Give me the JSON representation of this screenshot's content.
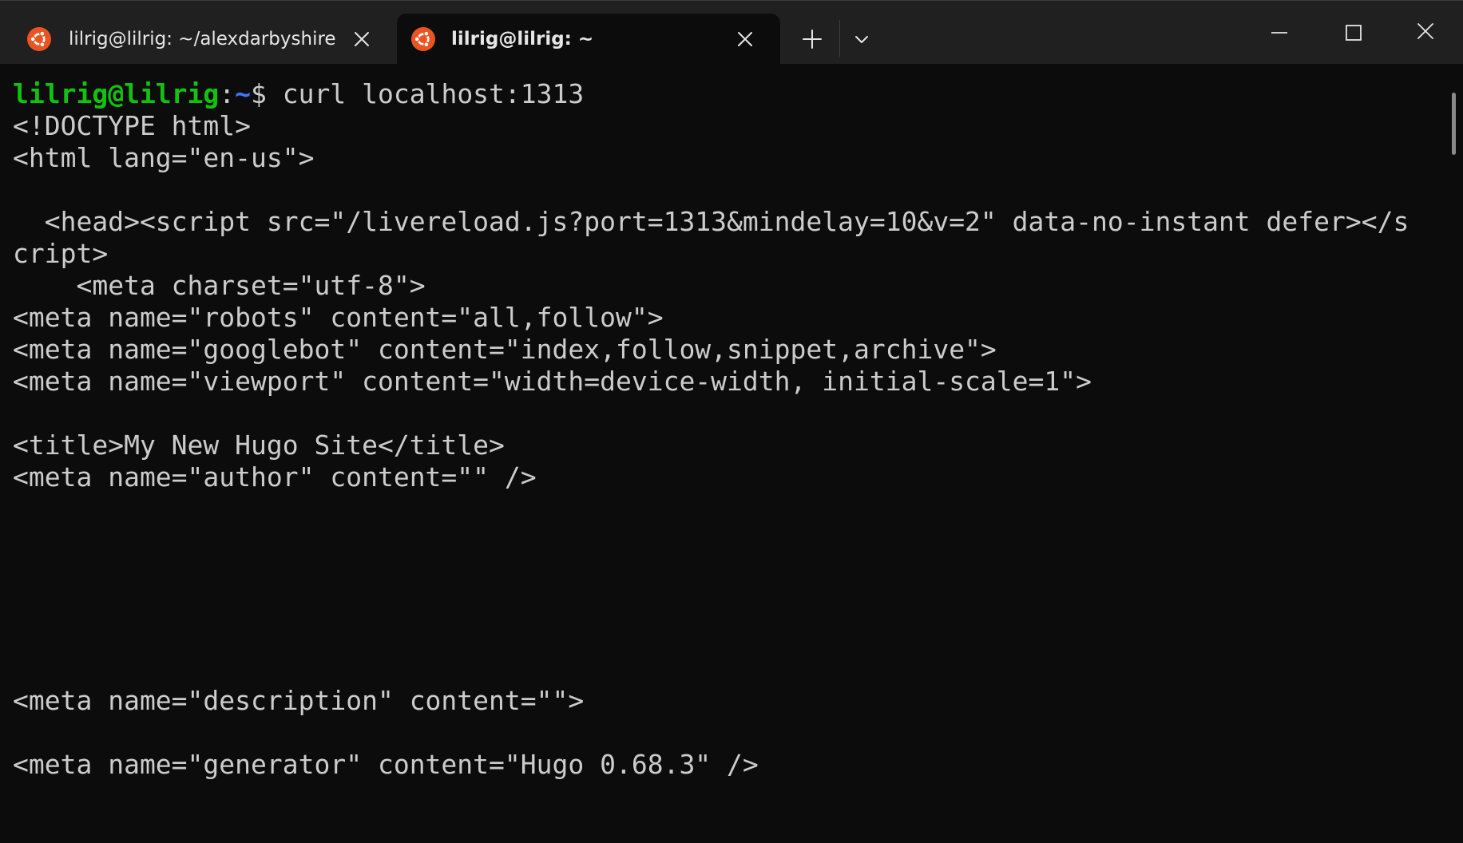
{
  "tabs": [
    {
      "title": "lilrig@lilrig: ~/alexdarbyshire",
      "icon": "ubuntu-icon",
      "active": false
    },
    {
      "title": "lilrig@lilrig: ~",
      "icon": "ubuntu-icon",
      "active": true
    }
  ],
  "colors": {
    "prompt_user": "#13c20e",
    "prompt_path": "#3b78ff",
    "terminal_bg": "#0c0c0c",
    "tabbar_bg": "#202020",
    "ubuntu_orange": "#e95420",
    "text": "#cccccc"
  },
  "terminal": {
    "prompt": {
      "user_host": "lilrig@lilrig",
      "colon": ":",
      "path": "~",
      "dollar": "$",
      "command": " curl localhost:1313"
    },
    "lines": [
      "<!DOCTYPE html>",
      "<html lang=\"en-us\">",
      "",
      "  <head><script src=\"/livereload.js?port=1313&mindelay=10&v=2\" data-no-instant defer></s",
      "cript>",
      "    <meta charset=\"utf-8\">",
      "<meta name=\"robots\" content=\"all,follow\">",
      "<meta name=\"googlebot\" content=\"index,follow,snippet,archive\">",
      "<meta name=\"viewport\" content=\"width=device-width, initial-scale=1\">",
      "",
      "<title>My New Hugo Site</title>",
      "<meta name=\"author\" content=\"\" />",
      "",
      "",
      "",
      "",
      "",
      "",
      "<meta name=\"description\" content=\"\">",
      "",
      "<meta name=\"generator\" content=\"Hugo 0.68.3\" />"
    ]
  }
}
